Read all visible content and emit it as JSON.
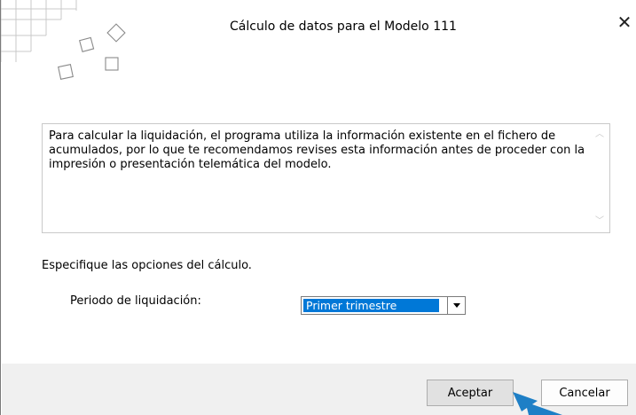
{
  "dialog": {
    "title": "Cálculo de datos para el Modelo 111",
    "close_icon": "close-icon",
    "info_text": "Para calcular la liquidación, el programa utiliza la información existente en el fichero de acumulados, por lo que te recomendamos revises esta información antes de proceder con la impresión o presentación telemática del modelo.",
    "section_label": "Especifique las opciones del cálculo.",
    "period": {
      "label": "Periodo de liquidación:",
      "selected": "Primer trimestre"
    },
    "buttons": {
      "ok": "Aceptar",
      "cancel": "Cancelar"
    }
  },
  "colors": {
    "selection": "#0078d7",
    "footer_bg": "#f0f0f0",
    "pointer": "#1e7fc6"
  }
}
